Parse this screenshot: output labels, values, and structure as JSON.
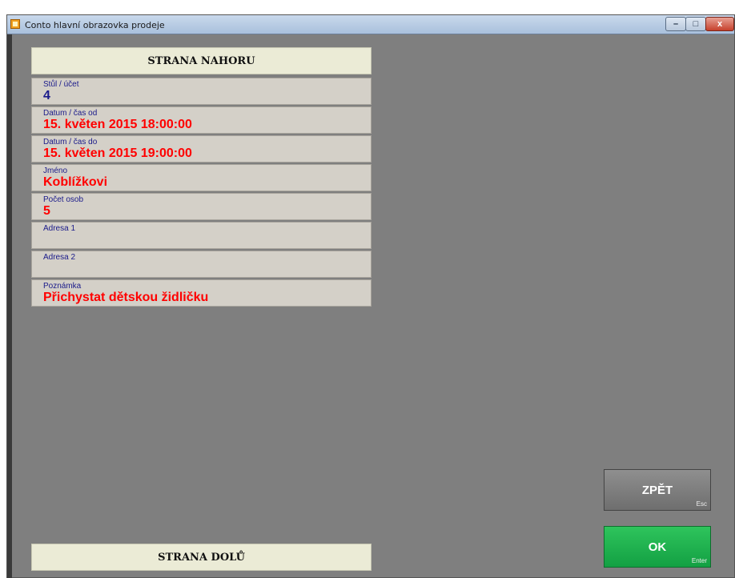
{
  "window": {
    "title": "Conto hlavní obrazovka prodeje",
    "controls": {
      "minimize": "–",
      "maximize": "□",
      "close": "x"
    }
  },
  "nav": {
    "page_up": "STRANA NAHORU",
    "page_down": "STRANA DOLŮ"
  },
  "fields": [
    {
      "label": "Stůl / účet",
      "value": "4",
      "value_color": "#1a1a8a"
    },
    {
      "label": "Datum / čas od",
      "value": "15. květen 2015 18:00:00",
      "value_color": "#ff0000"
    },
    {
      "label": "Datum / čas do",
      "value": "15. květen 2015 19:00:00",
      "value_color": "#ff0000"
    },
    {
      "label": "Jméno",
      "value": "Koblížkovi",
      "value_color": "#ff0000"
    },
    {
      "label": "Počet osob",
      "value": "5",
      "value_color": "#ff0000"
    },
    {
      "label": "Adresa 1",
      "value": "",
      "value_color": "#ff0000"
    },
    {
      "label": "Adresa 2",
      "value": "",
      "value_color": "#ff0000"
    },
    {
      "label": "Poznámka",
      "value": "Přichystat dětskou židličku",
      "value_color": "#ff0000"
    }
  ],
  "actions": {
    "back_label": "ZPĚT",
    "back_hotkey": "Esc",
    "ok_label": "OK",
    "ok_hotkey": "Enter"
  },
  "colors": {
    "background": "#7f7f7f",
    "panel_bg": "#d4d0c8",
    "nav_bg": "#ebebd6",
    "ok_green": "#13a043",
    "back_gray": "#7e7e7e"
  }
}
